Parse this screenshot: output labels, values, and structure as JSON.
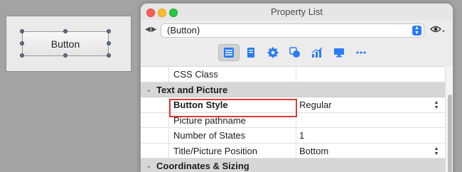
{
  "canvas": {
    "button_label": "Button"
  },
  "window": {
    "title": "Property List",
    "object_selector": {
      "value": "(Button)"
    },
    "nav": {
      "arrows": "◀▶"
    },
    "toolbar": [
      {
        "icon": "list-icon",
        "active": true
      },
      {
        "icon": "document-icon",
        "active": false
      },
      {
        "icon": "gear-icon",
        "active": false
      },
      {
        "icon": "shapes-icon",
        "active": false
      },
      {
        "icon": "chart-icon",
        "active": false
      },
      {
        "icon": "monitor-icon",
        "active": false
      },
      {
        "icon": "more-icon",
        "active": false
      }
    ]
  },
  "grid": {
    "row_css_class": {
      "name": "CSS Class",
      "value": ""
    },
    "section_text_picture": {
      "label": "Text and Picture"
    },
    "row_button_style": {
      "name": "Button Style",
      "value": "Regular"
    },
    "row_picture_pathname": {
      "name": "Picture pathname",
      "value": ""
    },
    "row_number_of_states": {
      "name": "Number of States",
      "value": "1"
    },
    "row_title_picture_position": {
      "name": "Title/Picture Position",
      "value": "Bottom"
    },
    "section_coordinates": {
      "label": "Coordinates & Sizing"
    }
  },
  "colors": {
    "accent": "#2a7cf6",
    "highlight": "#e03a33",
    "section_bg": "#d7d7d7"
  }
}
